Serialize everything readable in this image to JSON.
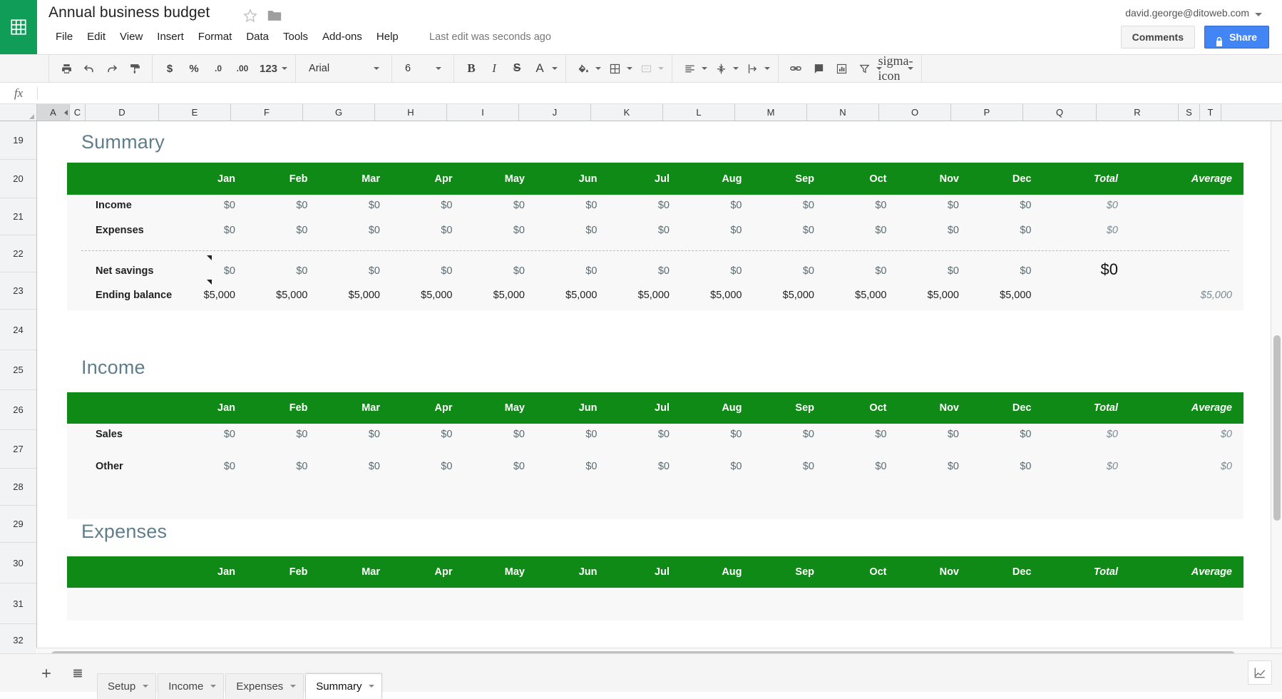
{
  "header": {
    "doc_title": "Annual business budget",
    "star_icon": "star-outline-icon",
    "folder_icon": "folder-icon",
    "menus": [
      "File",
      "Edit",
      "View",
      "Insert",
      "Format",
      "Data",
      "Tools",
      "Add-ons",
      "Help"
    ],
    "last_edit": "Last edit was seconds ago",
    "account_email": "david.george@ditoweb.com",
    "comments_label": "Comments",
    "share_label": "Share",
    "share_color": "#4285f4",
    "logo_color": "#0f9d58"
  },
  "toolbar": {
    "print": "print-icon",
    "undo": "undo-icon",
    "redo": "redo-icon",
    "paint_format": "paint-format-icon",
    "currency": "$",
    "percent": "%",
    "decrease_decimal": ".0",
    "increase_decimal": ".00",
    "more_formats": "123",
    "font_family": "Arial",
    "font_size": "6",
    "bold": "B",
    "italic": "I",
    "strikethrough": "S",
    "text_color": "A",
    "fill_color": "fill-color-icon",
    "borders": "borders-icon",
    "merge_cells": "merge-cells-icon",
    "horizontal_align": "align-left-icon",
    "vertical_align": "vertical-align-icon",
    "text_wrap": "text-wrap-icon",
    "insert_link": "link-icon",
    "insert_comment": "comment-icon",
    "insert_chart": "chart-icon",
    "filter": "filter-icon",
    "functions": "sigma-icon"
  },
  "formula_bar": {
    "fx_label": "fx",
    "value": "",
    "placeholder": ""
  },
  "grid": {
    "columns": [
      "A",
      "C",
      "D",
      "E",
      "F",
      "G",
      "H",
      "I",
      "J",
      "K",
      "L",
      "M",
      "N",
      "O",
      "P",
      "Q",
      "R",
      "S",
      "T"
    ],
    "rows": [
      "19",
      "20",
      "21",
      "22",
      "23",
      "24",
      "25",
      "26",
      "27",
      "28",
      "29",
      "30",
      "31",
      "32"
    ],
    "selected_column": "A"
  },
  "sections": [
    {
      "title": "Summary",
      "months": [
        "Jan",
        "Feb",
        "Mar",
        "Apr",
        "May",
        "Jun",
        "Jul",
        "Aug",
        "Sep",
        "Oct",
        "Nov",
        "Dec"
      ],
      "total_label": "Total",
      "average_label": "Average",
      "rows": [
        {
          "label": "Income",
          "values": [
            "$0",
            "$0",
            "$0",
            "$0",
            "$0",
            "$0",
            "$0",
            "$0",
            "$0",
            "$0",
            "$0",
            "$0"
          ],
          "total": "$0",
          "average": ""
        },
        {
          "label": "Expenses",
          "values": [
            "$0",
            "$0",
            "$0",
            "$0",
            "$0",
            "$0",
            "$0",
            "$0",
            "$0",
            "$0",
            "$0",
            "$0"
          ],
          "total": "$0",
          "average": ""
        },
        {
          "label": "Net savings",
          "values": [
            "$0",
            "$0",
            "$0",
            "$0",
            "$0",
            "$0",
            "$0",
            "$0",
            "$0",
            "$0",
            "$0",
            "$0"
          ],
          "total": "$0",
          "average": ""
        },
        {
          "label": "Ending balance",
          "values": [
            "$5,000",
            "$5,000",
            "$5,000",
            "$5,000",
            "$5,000",
            "$5,000",
            "$5,000",
            "$5,000",
            "$5,000",
            "$5,000",
            "$5,000",
            "$5,000"
          ],
          "total": "",
          "average": "$5,000"
        }
      ]
    },
    {
      "title": "Income",
      "months": [
        "Jan",
        "Feb",
        "Mar",
        "Apr",
        "May",
        "Jun",
        "Jul",
        "Aug",
        "Sep",
        "Oct",
        "Nov",
        "Dec"
      ],
      "total_label": "Total",
      "average_label": "Average",
      "rows": [
        {
          "label": "Sales",
          "values": [
            "$0",
            "$0",
            "$0",
            "$0",
            "$0",
            "$0",
            "$0",
            "$0",
            "$0",
            "$0",
            "$0",
            "$0"
          ],
          "total": "$0",
          "average": "$0"
        },
        {
          "label": "Other",
          "values": [
            "$0",
            "$0",
            "$0",
            "$0",
            "$0",
            "$0",
            "$0",
            "$0",
            "$0",
            "$0",
            "$0",
            "$0"
          ],
          "total": "$0",
          "average": "$0"
        }
      ]
    },
    {
      "title": "Expenses",
      "months": [
        "Jan",
        "Feb",
        "Mar",
        "Apr",
        "May",
        "Jun",
        "Jul",
        "Aug",
        "Sep",
        "Oct",
        "Nov",
        "Dec"
      ],
      "total_label": "Total",
      "average_label": "Average",
      "rows": []
    }
  ],
  "bottom": {
    "add_sheet_icon": "plus-icon",
    "all_sheets_icon": "list-icon",
    "tabs": [
      {
        "label": "Setup",
        "active": false
      },
      {
        "label": "Income",
        "active": false
      },
      {
        "label": "Expenses",
        "active": false
      },
      {
        "label": "Summary",
        "active": true
      }
    ],
    "explore_icon": "explore-icon"
  },
  "theme": {
    "header_green": "#0f8a16",
    "band_gray": "#f8f8f8",
    "section_title_color": "#607d8b"
  }
}
